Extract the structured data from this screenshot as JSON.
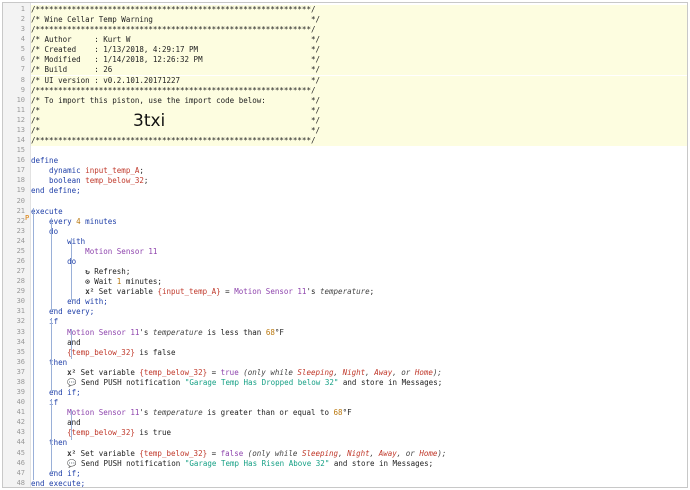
{
  "marker_22": "P",
  "big_import_code": "3txi",
  "lines": [
    {
      "n": "1",
      "comment": true,
      "tokens": [
        {
          "t": "/*************************************************************/",
          "c": "plain"
        }
      ]
    },
    {
      "n": "2",
      "comment": true,
      "tokens": [
        {
          "t": "/* Wine Cellar Temp Warning                                   */",
          "c": "plain"
        }
      ]
    },
    {
      "n": "3",
      "comment": true,
      "tokens": [
        {
          "t": "/*************************************************************/",
          "c": "plain"
        }
      ]
    },
    {
      "n": "4",
      "comment": true,
      "tokens": [
        {
          "t": "/* Author     : Kurt W                                        */",
          "c": "plain"
        }
      ]
    },
    {
      "n": "5",
      "comment": true,
      "tokens": [
        {
          "t": "/* Created    : 1/13/2018, 4:29:17 PM                         */",
          "c": "plain"
        }
      ]
    },
    {
      "n": "6",
      "comment": true,
      "tokens": [
        {
          "t": "/* Modified   : 1/14/2018, 12:26:32 PM                        */",
          "c": "plain"
        }
      ]
    },
    {
      "n": "7",
      "comment": true,
      "tokens": [
        {
          "t": "/* Build      : 26                                            */",
          "c": "plain"
        }
      ]
    },
    {
      "n": "8",
      "comment": true,
      "tokens": [
        {
          "t": "/* UI version : v0.2.101.20171227                             */",
          "c": "plain"
        }
      ]
    },
    {
      "n": "9",
      "comment": true,
      "tokens": [
        {
          "t": "/*************************************************************/",
          "c": "plain"
        }
      ]
    },
    {
      "n": "10",
      "comment": true,
      "tokens": [
        {
          "t": "/* To import this piston, use the import code below:          */",
          "c": "plain"
        }
      ]
    },
    {
      "n": "11",
      "comment": true,
      "tokens": [
        {
          "t": "/*                                                            */",
          "c": "plain"
        }
      ]
    },
    {
      "n": "12",
      "comment": true,
      "tokens": [
        {
          "t": "/*                                                            */",
          "c": "plain"
        }
      ]
    },
    {
      "n": "13",
      "comment": true,
      "tokens": [
        {
          "t": "/*                                                            */",
          "c": "plain"
        }
      ]
    },
    {
      "n": "14",
      "comment": true,
      "tokens": [
        {
          "t": "/*************************************************************/",
          "c": "plain"
        }
      ]
    },
    {
      "n": "15",
      "comment": false,
      "tokens": []
    },
    {
      "n": "16",
      "comment": false,
      "tokens": [
        {
          "t": "define",
          "c": "kw"
        }
      ]
    },
    {
      "n": "17",
      "comment": false,
      "tokens": [
        {
          "t": "    dynamic ",
          "c": "kw"
        },
        {
          "t": "input_temp_A",
          "c": "var"
        },
        {
          "t": ";",
          "c": "plain"
        }
      ]
    },
    {
      "n": "18",
      "comment": false,
      "tokens": [
        {
          "t": "    boolean ",
          "c": "kw"
        },
        {
          "t": "temp_below_32",
          "c": "var"
        },
        {
          "t": ";",
          "c": "plain"
        }
      ]
    },
    {
      "n": "19",
      "comment": false,
      "tokens": [
        {
          "t": "end define;",
          "c": "kw"
        }
      ]
    },
    {
      "n": "20",
      "comment": false,
      "tokens": []
    },
    {
      "n": "21",
      "comment": false,
      "tokens": [
        {
          "t": "execute",
          "c": "kw"
        }
      ]
    },
    {
      "n": "22",
      "comment": false,
      "tokens": [
        {
          "t": "    every ",
          "c": "kw"
        },
        {
          "t": "4",
          "c": "num"
        },
        {
          "t": " minutes",
          "c": "kw"
        }
      ]
    },
    {
      "n": "23",
      "comment": false,
      "tokens": [
        {
          "t": "    do",
          "c": "kw"
        }
      ]
    },
    {
      "n": "24",
      "comment": false,
      "tokens": [
        {
          "t": "        with",
          "c": "kw"
        }
      ]
    },
    {
      "n": "25",
      "comment": false,
      "tokens": [
        {
          "t": "            Motion Sensor 11",
          "c": "dev"
        }
      ]
    },
    {
      "n": "26",
      "comment": false,
      "tokens": [
        {
          "t": "        do",
          "c": "kw"
        }
      ]
    },
    {
      "n": "27",
      "comment": false,
      "tokens": [
        {
          "t": "            ",
          "c": "plain"
        },
        {
          "t": "↻",
          "c": "ic"
        },
        {
          "t": " Refresh;",
          "c": "plain"
        }
      ]
    },
    {
      "n": "28",
      "comment": false,
      "tokens": [
        {
          "t": "            ",
          "c": "plain"
        },
        {
          "t": "⊙",
          "c": "ic"
        },
        {
          "t": " Wait ",
          "c": "plain"
        },
        {
          "t": "1",
          "c": "num"
        },
        {
          "t": " minutes;",
          "c": "plain"
        }
      ]
    },
    {
      "n": "29",
      "comment": false,
      "tokens": [
        {
          "t": "            ",
          "c": "plain"
        },
        {
          "t": "x²",
          "c": "ic"
        },
        {
          "t": " Set variable ",
          "c": "plain"
        },
        {
          "t": "{input_temp_A}",
          "c": "var"
        },
        {
          "t": " = ",
          "c": "plain"
        },
        {
          "t": "Motion Sensor 11",
          "c": "dev"
        },
        {
          "t": "'s ",
          "c": "plain"
        },
        {
          "t": "temperature",
          "c": "it"
        },
        {
          "t": ";",
          "c": "plain"
        }
      ]
    },
    {
      "n": "30",
      "comment": false,
      "tokens": [
        {
          "t": "        end with;",
          "c": "kw"
        }
      ]
    },
    {
      "n": "31",
      "comment": false,
      "tokens": [
        {
          "t": "    end every;",
          "c": "kw"
        }
      ]
    },
    {
      "n": "32",
      "comment": false,
      "tokens": [
        {
          "t": "    if",
          "c": "kw"
        }
      ]
    },
    {
      "n": "33",
      "comment": false,
      "tokens": [
        {
          "t": "        Motion Sensor 11",
          "c": "dev"
        },
        {
          "t": "'s ",
          "c": "plain"
        },
        {
          "t": "temperature",
          "c": "it"
        },
        {
          "t": " is less than ",
          "c": "plain"
        },
        {
          "t": "68",
          "c": "num"
        },
        {
          "t": "°F",
          "c": "plain"
        }
      ]
    },
    {
      "n": "34",
      "comment": false,
      "tokens": [
        {
          "t": "        and",
          "c": "plain"
        }
      ]
    },
    {
      "n": "35",
      "comment": false,
      "tokens": [
        {
          "t": "        {temp_below_32}",
          "c": "var"
        },
        {
          "t": " is false",
          "c": "plain"
        }
      ]
    },
    {
      "n": "36",
      "comment": false,
      "tokens": [
        {
          "t": "    then",
          "c": "kw"
        }
      ]
    },
    {
      "n": "37",
      "comment": false,
      "tokens": [
        {
          "t": "        ",
          "c": "plain"
        },
        {
          "t": "x²",
          "c": "ic"
        },
        {
          "t": " Set variable ",
          "c": "plain"
        },
        {
          "t": "{temp_below_32}",
          "c": "var"
        },
        {
          "t": " = ",
          "c": "plain"
        },
        {
          "t": "true",
          "c": "dev"
        },
        {
          "t": " (only while ",
          "c": "it"
        },
        {
          "t": "Sleeping",
          "c": "itv"
        },
        {
          "t": ", ",
          "c": "it"
        },
        {
          "t": "Night",
          "c": "itv"
        },
        {
          "t": ", ",
          "c": "it"
        },
        {
          "t": "Away",
          "c": "itv"
        },
        {
          "t": ", or ",
          "c": "it"
        },
        {
          "t": "Home",
          "c": "itv"
        },
        {
          "t": ");",
          "c": "it"
        }
      ]
    },
    {
      "n": "38",
      "comment": false,
      "tokens": [
        {
          "t": "        ",
          "c": "plain"
        },
        {
          "t": "💬",
          "c": "ic"
        },
        {
          "t": " Send PUSH notification ",
          "c": "plain"
        },
        {
          "t": "\"Garage Temp Has Dropped below 32\"",
          "c": "str"
        },
        {
          "t": " and store in Messages;",
          "c": "plain"
        }
      ]
    },
    {
      "n": "39",
      "comment": false,
      "tokens": [
        {
          "t": "    end if;",
          "c": "kw"
        }
      ]
    },
    {
      "n": "40",
      "comment": false,
      "tokens": [
        {
          "t": "    if",
          "c": "kw"
        }
      ]
    },
    {
      "n": "41",
      "comment": false,
      "tokens": [
        {
          "t": "        Motion Sensor 11",
          "c": "dev"
        },
        {
          "t": "'s ",
          "c": "plain"
        },
        {
          "t": "temperature",
          "c": "it"
        },
        {
          "t": " is greater than or equal to ",
          "c": "plain"
        },
        {
          "t": "68",
          "c": "num"
        },
        {
          "t": "°F",
          "c": "plain"
        }
      ]
    },
    {
      "n": "42",
      "comment": false,
      "tokens": [
        {
          "t": "        and",
          "c": "plain"
        }
      ]
    },
    {
      "n": "43",
      "comment": false,
      "tokens": [
        {
          "t": "        {temp_below_32}",
          "c": "var"
        },
        {
          "t": " is true",
          "c": "plain"
        }
      ]
    },
    {
      "n": "44",
      "comment": false,
      "tokens": [
        {
          "t": "    then",
          "c": "kw"
        }
      ]
    },
    {
      "n": "45",
      "comment": false,
      "tokens": [
        {
          "t": "        ",
          "c": "plain"
        },
        {
          "t": "x²",
          "c": "ic"
        },
        {
          "t": " Set variable ",
          "c": "plain"
        },
        {
          "t": "{temp_below_32}",
          "c": "var"
        },
        {
          "t": " = ",
          "c": "plain"
        },
        {
          "t": "false",
          "c": "dev"
        },
        {
          "t": " (only while ",
          "c": "it"
        },
        {
          "t": "Sleeping",
          "c": "itv"
        },
        {
          "t": ", ",
          "c": "it"
        },
        {
          "t": "Night",
          "c": "itv"
        },
        {
          "t": ", ",
          "c": "it"
        },
        {
          "t": "Away",
          "c": "itv"
        },
        {
          "t": ", or ",
          "c": "it"
        },
        {
          "t": "Home",
          "c": "itv"
        },
        {
          "t": ");",
          "c": "it"
        }
      ]
    },
    {
      "n": "46",
      "comment": false,
      "tokens": [
        {
          "t": "        ",
          "c": "plain"
        },
        {
          "t": "💬",
          "c": "ic"
        },
        {
          "t": " Send PUSH notification ",
          "c": "plain"
        },
        {
          "t": "\"Garage Temp Has Risen Above 32\"",
          "c": "str"
        },
        {
          "t": " and store in Messages;",
          "c": "plain"
        }
      ]
    },
    {
      "n": "47",
      "comment": false,
      "tokens": [
        {
          "t": "    end if;",
          "c": "kw"
        }
      ]
    },
    {
      "n": "48",
      "comment": false,
      "tokens": [
        {
          "t": "end execute;",
          "c": "kw"
        }
      ]
    }
  ]
}
